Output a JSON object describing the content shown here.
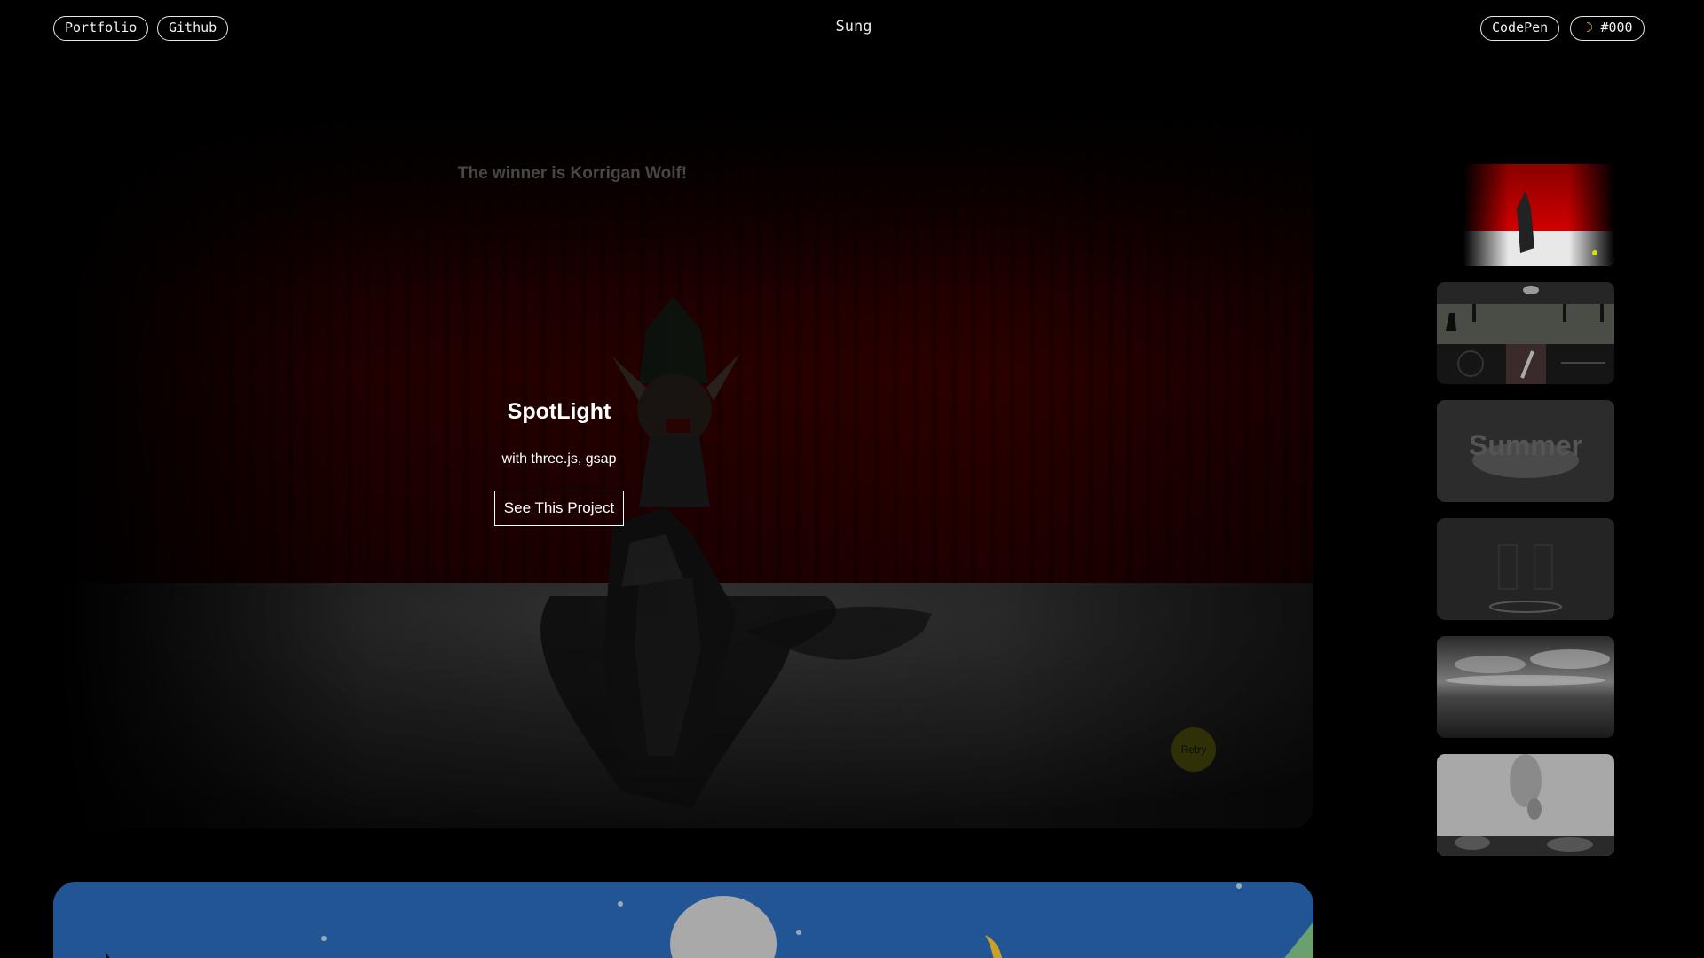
{
  "nav": {
    "portfolio_label": "Portfolio",
    "github_label": "Github",
    "site_title": "Sung",
    "codepen_label": "CodePen",
    "theme_label": "#000",
    "theme_icon": "moon-icon"
  },
  "feature": {
    "scene_caption": "The winner is Korrigan Wolf!",
    "retry_label": "Retry",
    "project_title": "SpotLight",
    "project_subtitle": "with three.js, gsap",
    "project_button": "See This Project"
  },
  "thumbnails": [
    {
      "id": "spotlight",
      "icon": "spotlight-thumbnail"
    },
    {
      "id": "characters",
      "icon": "scene-thumbnail"
    },
    {
      "id": "summer",
      "icon": "summer-thumbnail"
    },
    {
      "id": "carousel",
      "icon": "carousel-thumbnail"
    },
    {
      "id": "clouds",
      "icon": "clouds-thumbnail"
    },
    {
      "id": "smoke",
      "icon": "smoke-thumbnail"
    }
  ],
  "colors": {
    "background": "#000000",
    "curtain": "#7a0000",
    "second_card": "#225593",
    "retry": "#5a5a0a"
  }
}
